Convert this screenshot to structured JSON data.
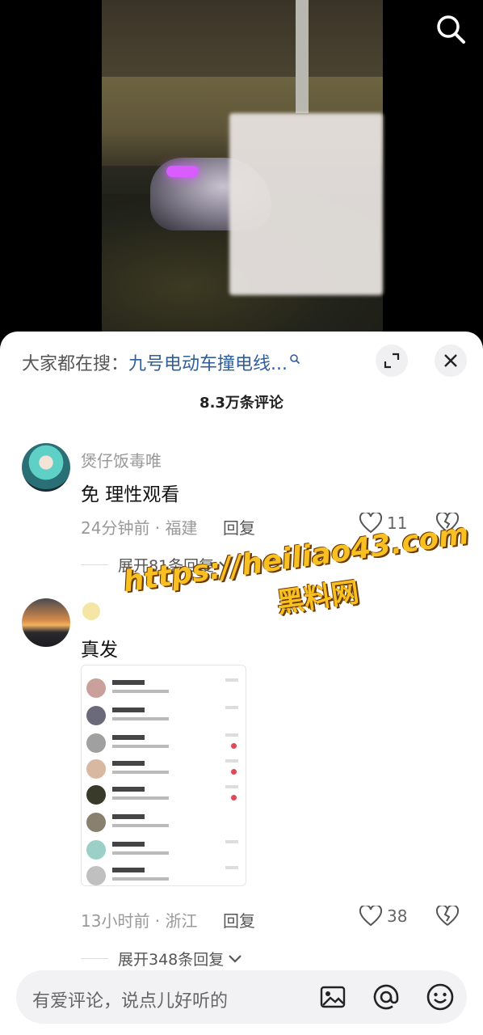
{
  "video": {
    "search_icon": "search-icon"
  },
  "panel": {
    "trend_prefix": "大家都在搜：",
    "trend_keyword": "九号电动车撞电线...",
    "comment_count": "8.3万条评论",
    "expand_icon": "expand-icon",
    "close_icon": "close-icon"
  },
  "comments": [
    {
      "username": "煲仔饭毒唯",
      "text": "免 理性观看",
      "time_location": "24分钟前 · 福建",
      "reply": "回复",
      "likes": "11",
      "more_replies": "展开81条回复"
    },
    {
      "username": "",
      "text": "真发",
      "time_location": "13小时前 · 浙江",
      "reply": "回复",
      "likes": "38",
      "more_replies": "展开348条回复"
    }
  ],
  "watermark": {
    "line1": "https://heiliao43.com",
    "line2": "黑料网"
  },
  "input": {
    "placeholder": "有爱评论，说点儿好听的"
  },
  "colors": {
    "keyword": "#2f5f9a",
    "watermark": "#f8c021"
  }
}
